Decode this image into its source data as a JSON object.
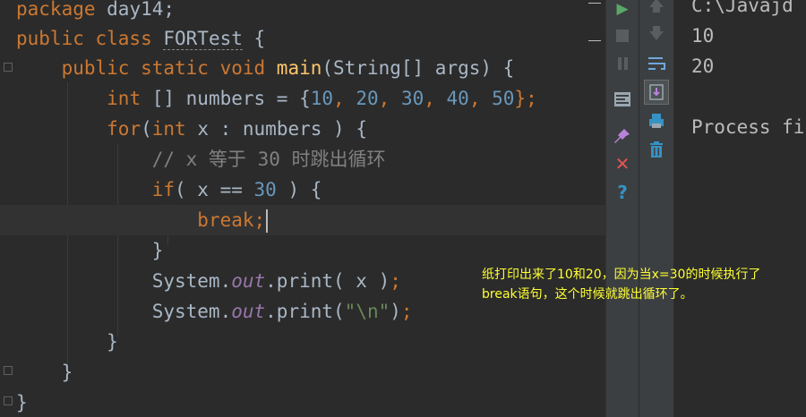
{
  "editor": {
    "lines": [
      {
        "segments": [
          {
            "t": "package ",
            "c": "kw"
          },
          {
            "t": "day14;",
            "c": "tx"
          }
        ]
      },
      {
        "segments": [
          {
            "t": "public class ",
            "c": "kw"
          },
          {
            "t": "FORTest",
            "c": "tx"
          },
          {
            "t": " {",
            "c": "tx"
          }
        ]
      },
      {
        "segments": [
          {
            "t": "    ",
            "c": "tx"
          },
          {
            "t": "public static void ",
            "c": "kw"
          },
          {
            "t": "main",
            "c": "fn"
          },
          {
            "t": "(String[] args) {",
            "c": "tx"
          }
        ]
      },
      {
        "segments": [
          {
            "t": "        ",
            "c": "tx"
          },
          {
            "t": "int ",
            "c": "kw"
          },
          {
            "t": "[] numbers = {",
            "c": "tx"
          },
          {
            "t": "10",
            "c": "num"
          },
          {
            "t": ", ",
            "c": "kw"
          },
          {
            "t": "20",
            "c": "num"
          },
          {
            "t": ", ",
            "c": "kw"
          },
          {
            "t": "30",
            "c": "num"
          },
          {
            "t": ", ",
            "c": "kw"
          },
          {
            "t": "40",
            "c": "num"
          },
          {
            "t": ", ",
            "c": "kw"
          },
          {
            "t": "50",
            "c": "num"
          },
          {
            "t": "};",
            "c": "kw"
          }
        ]
      },
      {
        "segments": [
          {
            "t": "        ",
            "c": "tx"
          },
          {
            "t": "for",
            "c": "kw"
          },
          {
            "t": "(",
            "c": "tx"
          },
          {
            "t": "int ",
            "c": "kw"
          },
          {
            "t": "x : numbers ) {",
            "c": "tx"
          }
        ]
      },
      {
        "segments": [
          {
            "t": "            ",
            "c": "tx"
          },
          {
            "t": "// x 等于 30 时跳出循环",
            "c": "cm"
          }
        ]
      },
      {
        "segments": [
          {
            "t": "            ",
            "c": "tx"
          },
          {
            "t": "if",
            "c": "kw"
          },
          {
            "t": "( x == ",
            "c": "tx"
          },
          {
            "t": "30",
            "c": "num"
          },
          {
            "t": " ) {",
            "c": "tx"
          }
        ]
      },
      {
        "segments": [
          {
            "t": "                ",
            "c": "tx"
          },
          {
            "t": "break;",
            "c": "kw"
          }
        ],
        "current": true
      },
      {
        "segments": [
          {
            "t": "            }",
            "c": "tx"
          }
        ]
      },
      {
        "segments": [
          {
            "t": "            System.",
            "c": "tx"
          },
          {
            "t": "out",
            "c": "fld"
          },
          {
            "t": ".print( x )",
            "c": "tx"
          },
          {
            "t": ";",
            "c": "kw"
          }
        ]
      },
      {
        "segments": [
          {
            "t": "            System.",
            "c": "tx"
          },
          {
            "t": "out",
            "c": "fld"
          },
          {
            "t": ".print(",
            "c": "tx"
          },
          {
            "t": "\"\\n\"",
            "c": "st"
          },
          {
            "t": ")",
            "c": "tx"
          },
          {
            "t": ";",
            "c": "kw"
          }
        ]
      },
      {
        "segments": [
          {
            "t": "        }",
            "c": "tx"
          }
        ]
      },
      {
        "segments": [
          {
            "t": "    }",
            "c": "tx"
          }
        ]
      },
      {
        "segments": [
          {
            "t": "}",
            "c": "tx"
          }
        ]
      }
    ]
  },
  "console": {
    "lines": [
      "C:\\Javajd",
      "10",
      "20",
      "",
      "Process fi"
    ]
  },
  "toolbar": {
    "run_icon": "run-icon",
    "stop_icon": "stop-icon",
    "pause_icon": "pause-icon",
    "dump_icon": "dump-threads-icon",
    "pin_icon": "pin-icon",
    "close_icon": "close-icon",
    "help_icon": "help-icon",
    "up_icon": "arrow-up-icon",
    "down_icon": "arrow-down-icon",
    "wrap_icon": "soft-wrap-icon",
    "scroll_end_icon": "scroll-to-end-icon",
    "print_icon": "print-icon",
    "trash_icon": "trash-icon"
  },
  "annotation": {
    "text": "纸打印出来了10和20，因为当x=30的时候执行了break语句，这个时候就跳出循环了。"
  },
  "colors": {
    "background": "#2b2b2b",
    "keyword": "#cc7832",
    "number": "#6897bb",
    "comment": "#808080",
    "function": "#ffc66d",
    "string": "#6a8759",
    "field": "#9876aa",
    "text": "#a9b7c6",
    "annotation": "#ffff33"
  }
}
